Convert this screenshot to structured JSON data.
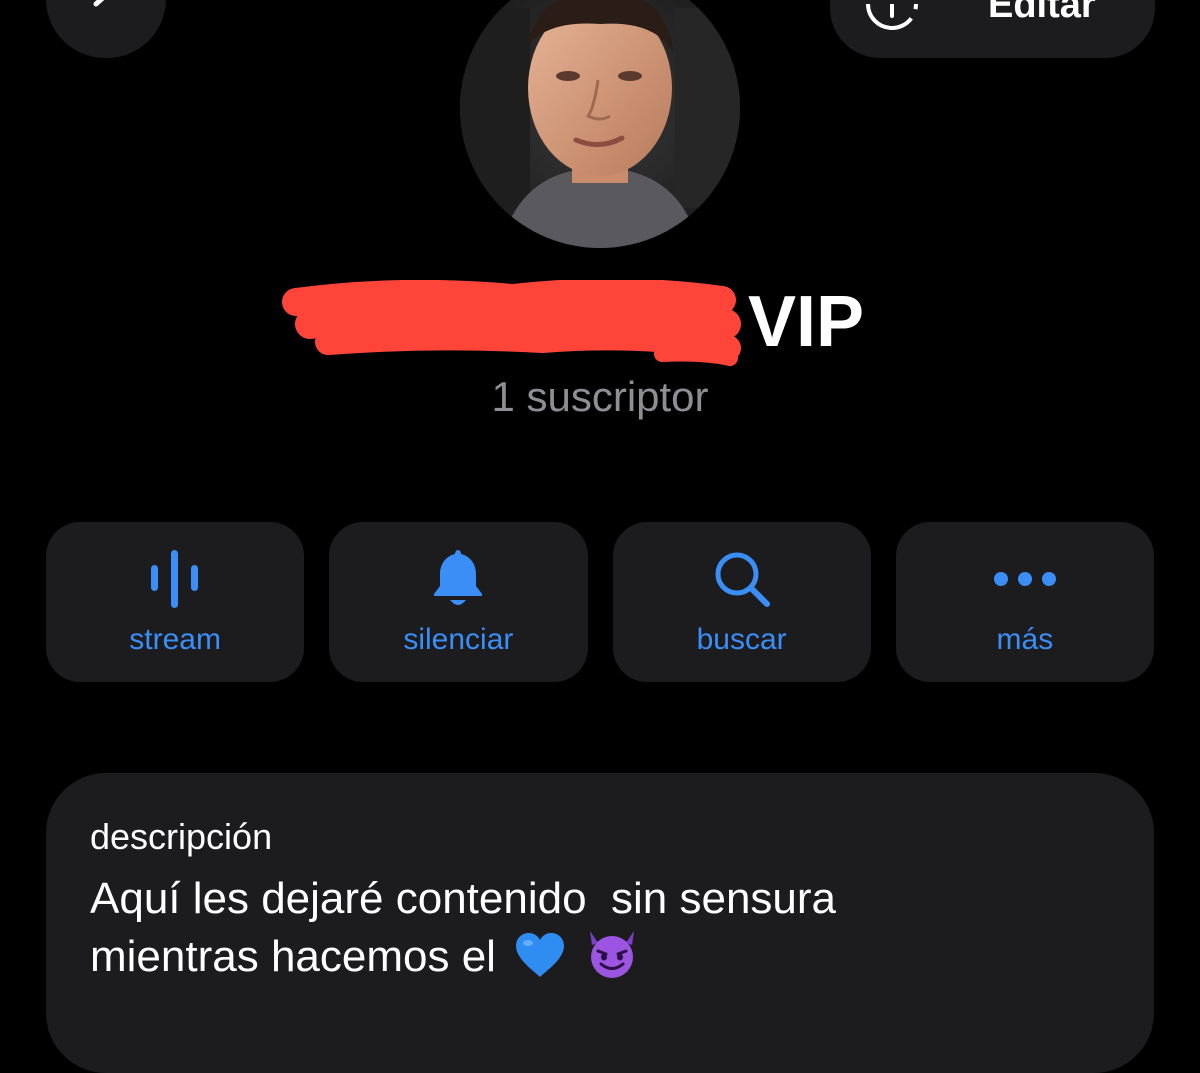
{
  "nav": {
    "back_icon": "chevron-left-icon",
    "edit_label": "Editar",
    "edit_icon": "edit-circle-icon"
  },
  "profile": {
    "name_suffix": "VIP",
    "subscribers": "1 suscriptor",
    "redaction_color": "#ff453a"
  },
  "actions": [
    {
      "label": "stream",
      "icon": "waveform-icon"
    },
    {
      "label": "silenciar",
      "icon": "bell-icon"
    },
    {
      "label": "buscar",
      "icon": "search-icon"
    },
    {
      "label": "más",
      "icon": "more-dots-icon"
    }
  ],
  "description": {
    "title": "descripción",
    "line1": "Aquí les dejaré contenido  sin sensura",
    "line2": "mientras hacemos el",
    "emojis": [
      "blue-heart-icon",
      "smiling-imp-icon"
    ]
  },
  "colors": {
    "background": "#000000",
    "card": "#1c1c1e",
    "accent": "#3a8ef6",
    "secondary_text": "#8e8e93"
  }
}
